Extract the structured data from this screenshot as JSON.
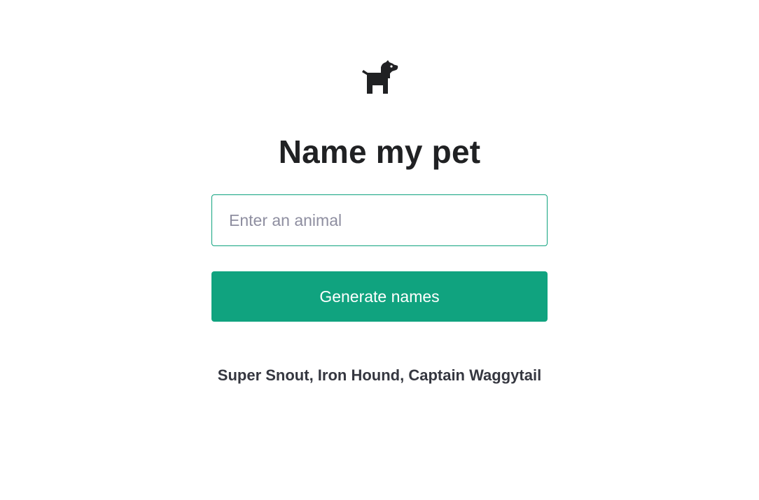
{
  "header": {
    "logo_icon": "dog-icon",
    "title": "Name my pet"
  },
  "form": {
    "animal_input": {
      "placeholder": "Enter an animal",
      "value": ""
    },
    "submit_label": "Generate names"
  },
  "result": {
    "text": "Super Snout, Iron Hound, Captain Waggytail"
  },
  "colors": {
    "accent": "#10a37f",
    "text": "#202123",
    "result_text": "#353740",
    "placeholder": "#8e8ea0"
  }
}
